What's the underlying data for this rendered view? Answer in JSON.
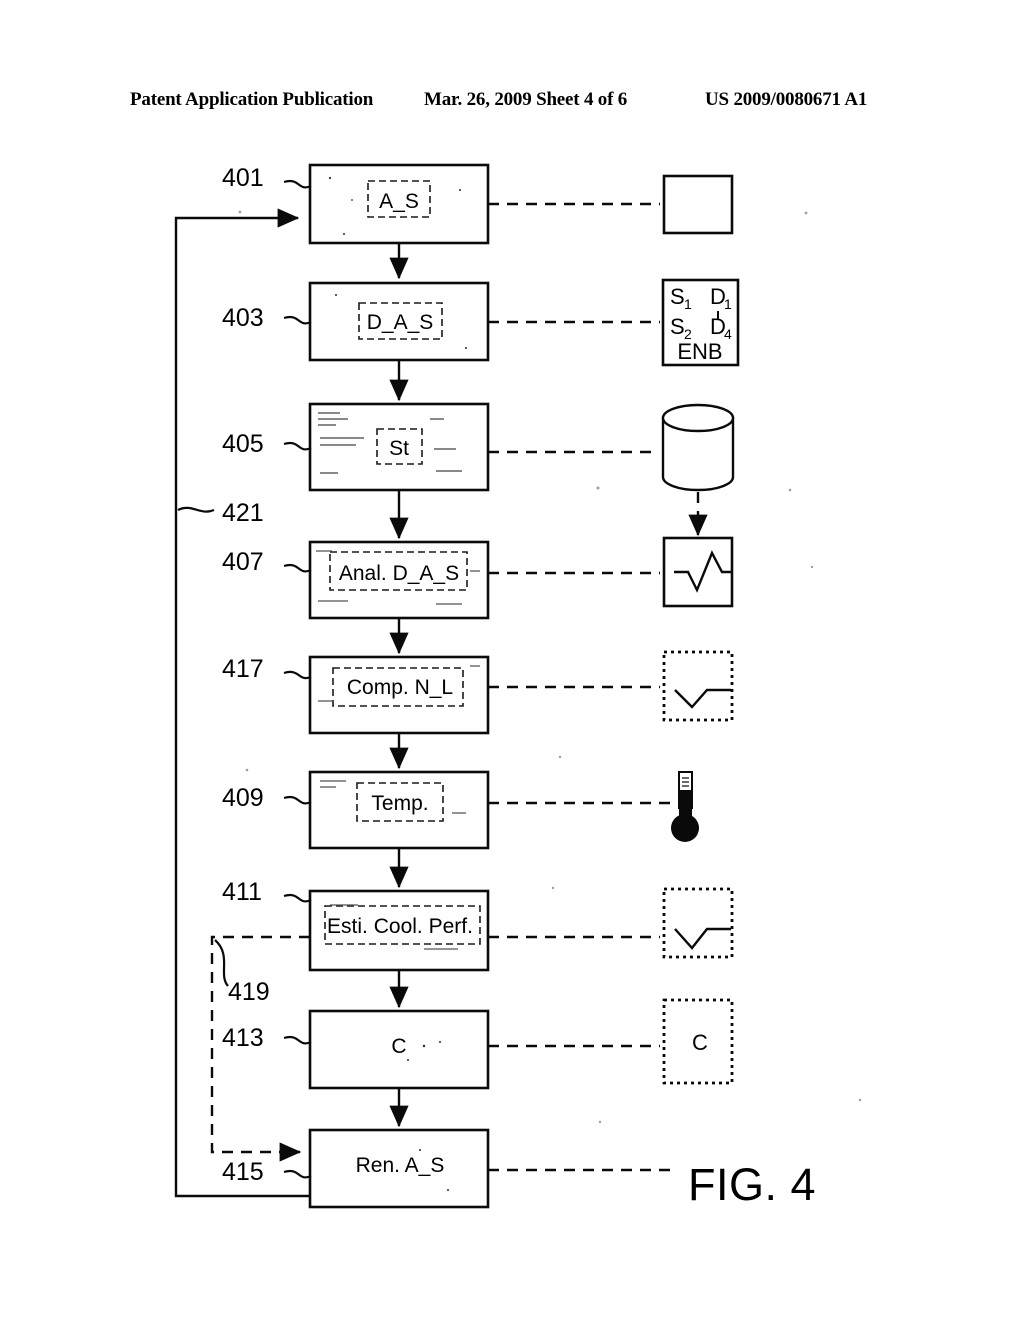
{
  "header": {
    "left": "Patent Application Publication",
    "middle": "Mar. 26, 2009  Sheet 4 of 6",
    "right": "US 2009/0080671 A1"
  },
  "figure": {
    "caption": "FIG. 4"
  },
  "flow": {
    "blocks": [
      {
        "ref": "401",
        "label": "A_S",
        "dashed_inner": true
      },
      {
        "ref": "403",
        "label": "D_A_S",
        "dashed_inner": true
      },
      {
        "ref": "405",
        "label": "St",
        "dashed_inner": true
      },
      {
        "ref": "407",
        "label": "Anal. D_A_S",
        "dashed_inner": true
      },
      {
        "ref": "417",
        "label": "Comp. N_L",
        "dashed_inner": true
      },
      {
        "ref": "409",
        "label": "Temp.",
        "dashed_inner": true
      },
      {
        "ref": "411",
        "label": "Esti. Cool. Perf.",
        "dashed_inner": true
      },
      {
        "ref": "413",
        "label": "C",
        "dashed_inner": false
      },
      {
        "ref": "415",
        "label": "Ren. A_S",
        "dashed_inner": false
      }
    ],
    "loops": [
      {
        "ref": "421",
        "style": "solid",
        "from": "415",
        "to": "401"
      },
      {
        "ref": "419",
        "style": "dashed",
        "from": "411",
        "to": "415"
      }
    ]
  },
  "icons": [
    {
      "for": "401",
      "name": "empty-square-icon",
      "border": "solid",
      "content": ""
    },
    {
      "for": "403",
      "name": "signal-pins-icon",
      "border": "solid",
      "pins": {
        "s1": "S",
        "s1sub": "1",
        "d1": "D",
        "d1sub": "1",
        "s2": "S",
        "s2sub": "2",
        "d2": "D",
        "d2sub": "4",
        "enb": "ENB"
      }
    },
    {
      "for": "405",
      "name": "database-cylinder-icon",
      "border": "none",
      "content": ""
    },
    {
      "for": "407",
      "name": "waveform-peak-icon",
      "border": "solid",
      "content": ""
    },
    {
      "for": "417",
      "name": "waveform-dip-icon",
      "border": "dotted",
      "content": ""
    },
    {
      "for": "409",
      "name": "thermometer-icon",
      "border": "none",
      "content": ""
    },
    {
      "for": "411",
      "name": "waveform-dip-icon",
      "border": "dotted",
      "content": ""
    },
    {
      "for": "413",
      "name": "letter-c-icon",
      "border": "dotted",
      "content": "C"
    }
  ]
}
